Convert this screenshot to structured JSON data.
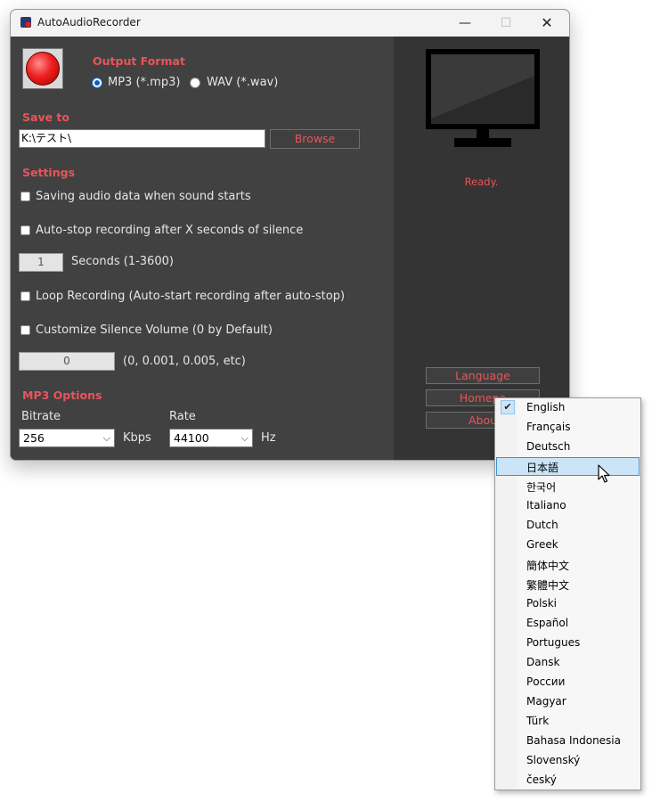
{
  "window": {
    "title": "AutoAudioRecorder",
    "controls": {
      "minimize": "—",
      "maximize": "☐",
      "close": "✕"
    }
  },
  "output_format": {
    "title": "Output Format",
    "options": [
      {
        "label": "MP3 (*.mp3)",
        "selected": true
      },
      {
        "label": "WAV (*.wav)",
        "selected": false
      }
    ]
  },
  "save_to": {
    "title": "Save to",
    "path": "K:\\テスト\\",
    "browse_label": "Browse"
  },
  "settings": {
    "title": "Settings",
    "saving_on_sound": {
      "label": "Saving audio data when sound starts",
      "checked": false
    },
    "auto_stop": {
      "label": "Auto-stop recording after X seconds of silence",
      "checked": false
    },
    "seconds_value": "1",
    "seconds_label": "Seconds (1-3600)",
    "loop": {
      "label": "Loop Recording (Auto-start recording after auto-stop)",
      "checked": false
    },
    "silence_volume": {
      "label": "Customize Silence Volume (0 by Default)",
      "checked": false
    },
    "silence_value": "0",
    "silence_hint": "(0, 0.001, 0.005, etc)"
  },
  "mp3_options": {
    "title": "MP3 Options",
    "bitrate_label": "Bitrate",
    "bitrate_value": "256",
    "bitrate_unit": "Kbps",
    "rate_label": "Rate",
    "rate_value": "44100",
    "rate_unit": "Hz"
  },
  "side_panel": {
    "status": "Ready.",
    "language_button": "Language",
    "homepage_button": "Homepa",
    "about_button": "Abou"
  },
  "language_menu": {
    "items": [
      {
        "label": "English",
        "checked": true
      },
      {
        "label": "Français"
      },
      {
        "label": "Deutsch"
      },
      {
        "label": "日本語",
        "highlighted": true
      },
      {
        "label": "한국어"
      },
      {
        "label": "Italiano"
      },
      {
        "label": "Dutch"
      },
      {
        "label": "Greek"
      },
      {
        "label": "簡体中文"
      },
      {
        "label": "繁體中文"
      },
      {
        "label": "Polski"
      },
      {
        "label": "Español"
      },
      {
        "label": "Portugues"
      },
      {
        "label": "Dansk"
      },
      {
        "label": "России"
      },
      {
        "label": "Magyar"
      },
      {
        "label": "Türk"
      },
      {
        "label": "Bahasa Indonesia"
      },
      {
        "label": "Slovenský"
      },
      {
        "label": "český"
      }
    ]
  },
  "colors": {
    "accent": "#e8555a",
    "panel_left": "#414141",
    "panel_right": "#343434",
    "menu_highlight": "#cce4f7"
  }
}
